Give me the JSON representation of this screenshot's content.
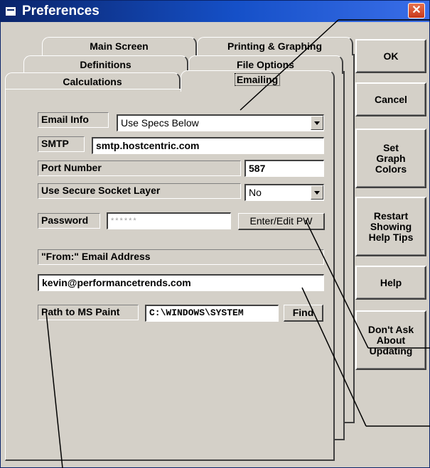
{
  "window": {
    "title": "Preferences",
    "close_glyph": "✕"
  },
  "tabs": {
    "row1": [
      "Main Screen",
      "Printing & Graphing"
    ],
    "row2": [
      "Definitions",
      "File Options"
    ],
    "row3": [
      "Calculations",
      "Emailing"
    ],
    "active": "Emailing"
  },
  "side_buttons": {
    "ok": "OK",
    "cancel": "Cancel",
    "graph_colors": "Set\nGraph\nColors",
    "help_tips": "Restart\nShowing\nHelp Tips",
    "help": "Help",
    "dont_ask": "Don't Ask\nAbout\nUpdating"
  },
  "form": {
    "email_info_label": "Email Info",
    "email_info_value": "Use Specs Below",
    "smtp_label": "SMTP",
    "smtp_value": "smtp.hostcentric.com",
    "port_label": "Port Number",
    "port_value": "587",
    "ssl_label": "Use Secure Socket Layer",
    "ssl_value": "No",
    "password_label": "Password",
    "password_value": "******",
    "edit_pw_button": "Enter/Edit PW",
    "from_label": "\"From:\" Email Address",
    "from_value": "kevin@performancetrends.com",
    "paint_label": "Path to MS Paint",
    "paint_value": "C:\\WINDOWS\\SYSTEM",
    "find_button": "Find"
  },
  "icons": {
    "app": "window-icon",
    "close": "close-icon",
    "dropdown": "dropdown-arrow-icon"
  }
}
